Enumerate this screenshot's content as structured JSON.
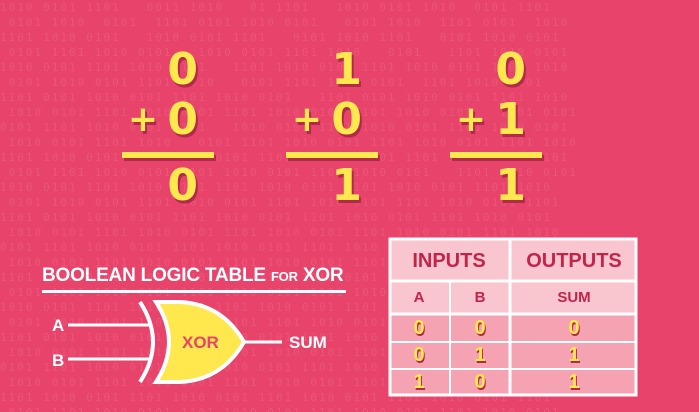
{
  "sums": [
    {
      "top": "0",
      "operator": "+",
      "bottom": "0",
      "result": "0"
    },
    {
      "top": "1",
      "operator": "+",
      "bottom": "0",
      "result": "1"
    },
    {
      "top": "0",
      "operator": "+",
      "bottom": "1",
      "result": "1"
    }
  ],
  "title": {
    "main": "BOOLEAN LOGIC TABLE",
    "for": "FOR",
    "gate": "XOR"
  },
  "gate": {
    "input_a": "A",
    "input_b": "B",
    "label": "XOR",
    "output": "SUM"
  },
  "table": {
    "inputs_header": "INPUTS",
    "outputs_header": "OUTPUTS",
    "col_a": "A",
    "col_b": "B",
    "col_sum": "SUM",
    "rows": [
      {
        "a": "0",
        "b": "0",
        "sum": "0"
      },
      {
        "a": "0",
        "b": "1",
        "sum": "1"
      },
      {
        "a": "1",
        "b": "0",
        "sum": "1"
      }
    ]
  },
  "colors": {
    "background": "#e8436a",
    "accent": "#ffe84d",
    "table_fill": "#f5a3b2",
    "table_head": "#f9c6cf",
    "outline": "#ffffff"
  }
}
